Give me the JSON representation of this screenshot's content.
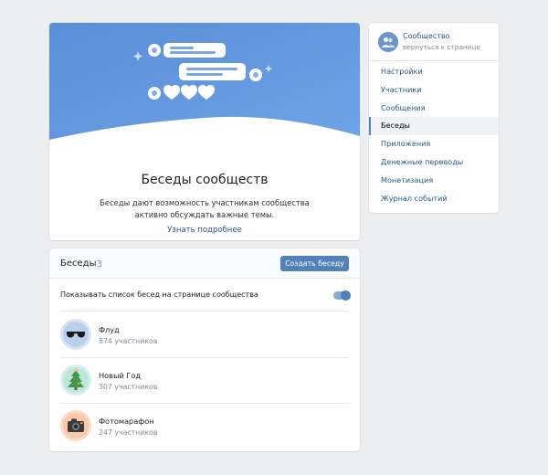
{
  "promo": {
    "title": "Беседы сообществ",
    "description": "Беседы дают возможность участникам сообщества активно обсуждать важные темы.",
    "learn_more": "Узнать подробнее",
    "banner_color": "#5b8fd8"
  },
  "sidebar": {
    "community_name": "Сообщество",
    "back_link": "вернуться к странице",
    "items": [
      {
        "label": "Настройки",
        "active": false
      },
      {
        "label": "Участники",
        "active": false
      },
      {
        "label": "Сообщения",
        "active": false
      },
      {
        "label": "Беседы",
        "active": true
      },
      {
        "label": "Приложения",
        "active": false
      },
      {
        "label": "Денежные переводы",
        "active": false
      },
      {
        "label": "Монетизация",
        "active": false
      },
      {
        "label": "Журнал событий",
        "active": false
      }
    ]
  },
  "chats": {
    "title": "Беседы",
    "count": "3",
    "create_button": "Создать беседу",
    "toggle_label": "Показывать список бесед на странице сообщества",
    "toggle_on": true,
    "items": [
      {
        "name": "Флуд",
        "members": "874 участников",
        "icon": "sunglasses-icon"
      },
      {
        "name": "Новый Год",
        "members": "307 участников",
        "icon": "christmas-tree-icon"
      },
      {
        "name": "Фотомарафон",
        "members": "247 участников",
        "icon": "camera-icon"
      }
    ]
  },
  "colors": {
    "accent": "#5181b8",
    "link": "#2a5885",
    "background": "#edeef0"
  }
}
